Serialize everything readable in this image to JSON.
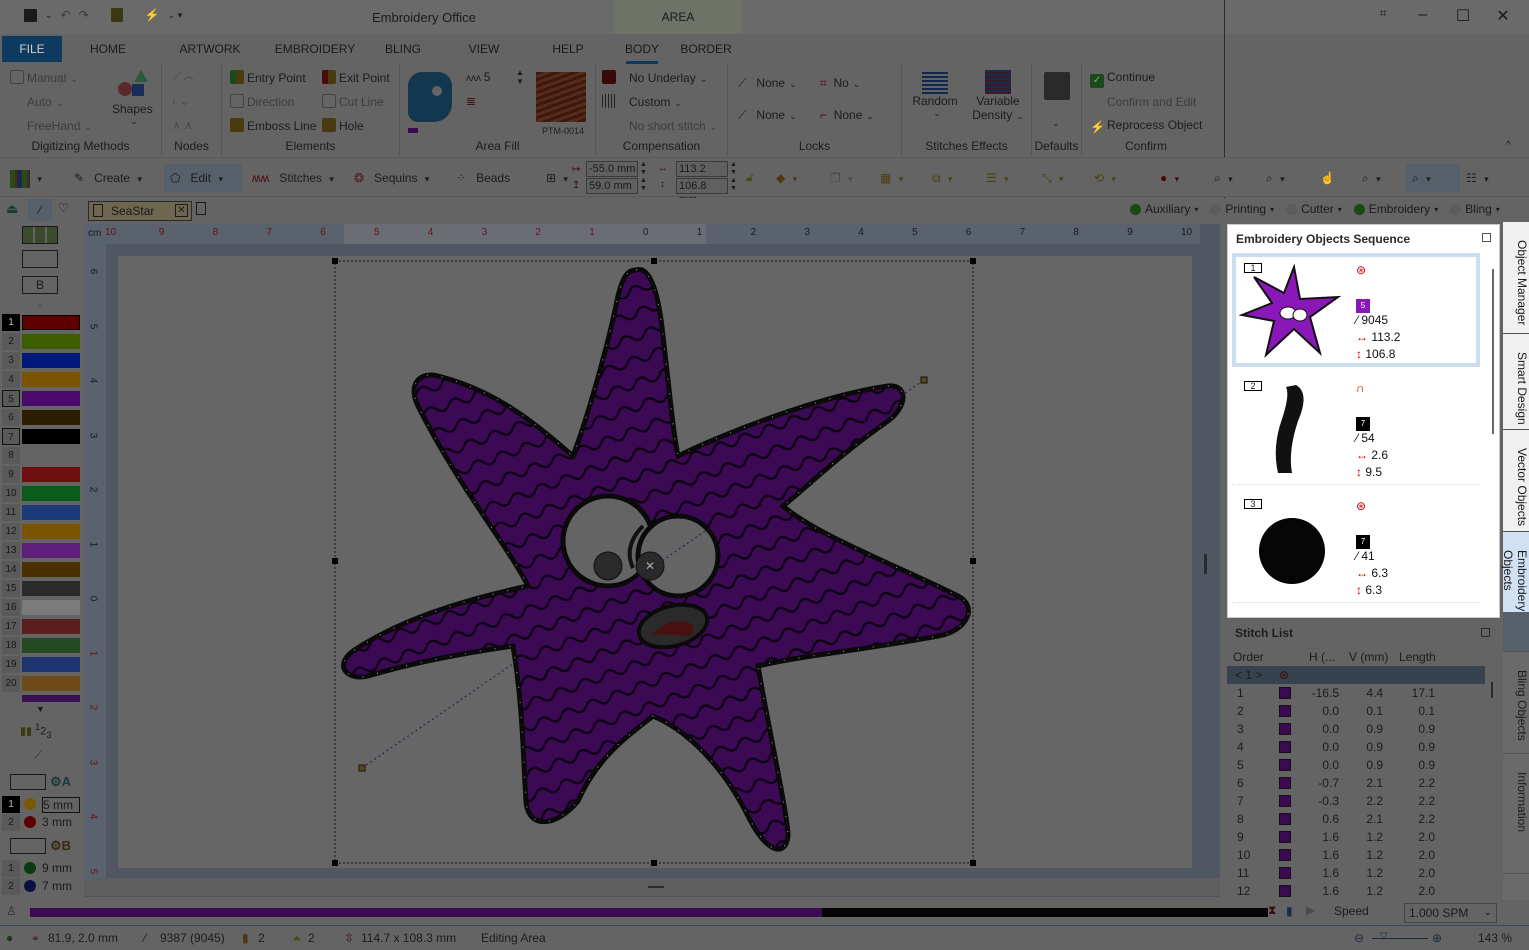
{
  "window": {
    "title": "Embroidery Office",
    "context_tab_group": "AREA",
    "controls": [
      "screenshot-icon",
      "minimize-icon",
      "maximize-icon",
      "close-icon"
    ]
  },
  "quick_access": [
    "save-icon",
    "undo-icon",
    "redo-icon",
    "paste-icon",
    "reprocess-icon"
  ],
  "tabs": [
    {
      "label": "FILE",
      "active": false
    },
    {
      "label": "HOME",
      "active": false
    },
    {
      "label": "ARTWORK",
      "active": false
    },
    {
      "label": "EMBROIDERY",
      "active": false
    },
    {
      "label": "BLING",
      "active": false
    },
    {
      "label": "VIEW",
      "active": false
    },
    {
      "label": "HELP",
      "active": false
    },
    {
      "label": "BODY",
      "active": true
    },
    {
      "label": "BORDER",
      "active": false
    }
  ],
  "ribbon": {
    "digitizing": {
      "label": "Digitizing Methods",
      "manual": "Manual",
      "auto": "Auto",
      "freehand": "FreeHand",
      "shapes": "Shapes"
    },
    "nodes": {
      "label": "Nodes"
    },
    "elements": {
      "label": "Elements",
      "entry_point": "Entry Point",
      "exit_point": "Exit Point",
      "direction": "Direction",
      "cut_line": "Cut Line",
      "emboss_line": "Emboss Line",
      "hole": "Hole"
    },
    "area_fill": {
      "label": "Area Fill",
      "density": "5",
      "pattern_name": "PTM-0014"
    },
    "compensation": {
      "label": "Compensation",
      "underlay": "No Underlay",
      "custom": "Custom",
      "short_stitch": "No short stitch"
    },
    "locks": {
      "label": "Locks",
      "start_lock": "None",
      "end_lock": "None",
      "trim_start": "No",
      "trim_end": "None"
    },
    "stitch_effects": {
      "label": "Stitches Effects",
      "random": "Random",
      "variable_density_1": "Variable",
      "variable_density_2": "Density"
    },
    "defaults": {
      "label": "Defaults"
    },
    "confirm": {
      "label": "Confirm",
      "continue": "Continue",
      "confirm_edit": "Confirm and Edit",
      "reprocess": "Reprocess Object"
    }
  },
  "toolbar": {
    "create": "Create",
    "edit": "Edit",
    "stitches": "Stitches",
    "sequins": "Sequins",
    "beads": "Beads",
    "pos_x": "-55.0 mm",
    "pos_y": "59.0 mm",
    "width": "113.2 mm",
    "height": "106.8 mm"
  },
  "document": {
    "tab_name": "SeaStar",
    "ruler_unit": "cm"
  },
  "layer_filters": [
    {
      "label": "Auxiliary",
      "on": true
    },
    {
      "label": "Printing",
      "on": false
    },
    {
      "label": "Cutter",
      "on": false
    },
    {
      "label": "Embroidery",
      "on": true
    },
    {
      "label": "Bling",
      "on": false
    }
  ],
  "palette": {
    "colors": [
      {
        "n": "1",
        "hex": "#5e0000",
        "sel": true
      },
      {
        "n": "2",
        "hex": "#3e5c00"
      },
      {
        "n": "3",
        "hex": "#001a7a"
      },
      {
        "n": "4",
        "hex": "#7a5400"
      },
      {
        "n": "5",
        "hex": "#4a0a6a",
        "box": true
      },
      {
        "n": "6",
        "hex": "#2e1e00"
      },
      {
        "n": "7",
        "hex": "#000000",
        "box": true
      },
      {
        "n": "8",
        "hex": "#646464"
      },
      {
        "n": "9",
        "hex": "#6e1010"
      },
      {
        "n": "10",
        "hex": "#0a5a1a"
      },
      {
        "n": "11",
        "hex": "#1c3a7a"
      },
      {
        "n": "12",
        "hex": "#7a5400"
      },
      {
        "n": "13",
        "hex": "#5e1e7a"
      },
      {
        "n": "14",
        "hex": "#4a3000"
      },
      {
        "n": "15",
        "hex": "#2a2a2a"
      },
      {
        "n": "16",
        "hex": "#7a7a7a"
      },
      {
        "n": "17",
        "hex": "#5a1e1e"
      },
      {
        "n": "18",
        "hex": "#244a24"
      },
      {
        "n": "19",
        "hex": "#1e3470"
      },
      {
        "n": "20",
        "hex": "#6e4a18"
      }
    ],
    "sequins_a": [
      {
        "n": "1",
        "size": "5 mm",
        "color": "#7a5a00",
        "sel": true
      },
      {
        "n": "2",
        "size": "3 mm",
        "color": "#5a0000"
      }
    ],
    "sequins_b": [
      {
        "n": "1",
        "size": "9 mm",
        "color": "#0a3a10"
      },
      {
        "n": "2",
        "size": "7 mm",
        "color": "#0a1040"
      }
    ],
    "set_a": "A",
    "set_b": "B",
    "b_button": "B"
  },
  "sequence_panel": {
    "title": "Embroidery Objects Sequence",
    "items": [
      {
        "num": "1",
        "type": "area-fill",
        "color_num": "5",
        "color": "#8a18b8",
        "stitches": "9045",
        "width": "113.2",
        "height": "106.8"
      },
      {
        "num": "2",
        "type": "satin-line",
        "color_num": "7",
        "color": "#000000",
        "stitches": "54",
        "width": "2.6",
        "height": "9.5"
      },
      {
        "num": "3",
        "type": "area-fill",
        "color_num": "7",
        "color": "#000000",
        "stitches": "41",
        "width": "6.3",
        "height": "6.3"
      }
    ]
  },
  "stitch_list": {
    "title": "Stitch List",
    "columns": [
      "Order",
      "",
      "H (...",
      "V (mm)",
      "Length"
    ],
    "group_label": "< 1 >",
    "rows": [
      {
        "order": "1",
        "h": "-16.5",
        "v": "4.4",
        "len": "17.1"
      },
      {
        "order": "2",
        "h": "0.0",
        "v": "0.1",
        "len": "0.1"
      },
      {
        "order": "3",
        "h": "0.0",
        "v": "0.9",
        "len": "0.9"
      },
      {
        "order": "4",
        "h": "0.0",
        "v": "0.9",
        "len": "0.9"
      },
      {
        "order": "5",
        "h": "0.0",
        "v": "0.9",
        "len": "0.9"
      },
      {
        "order": "6",
        "h": "-0.7",
        "v": "2.1",
        "len": "2.2"
      },
      {
        "order": "7",
        "h": "-0.3",
        "v": "2.2",
        "len": "2.2"
      },
      {
        "order": "8",
        "h": "0.6",
        "v": "2.1",
        "len": "2.2"
      },
      {
        "order": "9",
        "h": "1.6",
        "v": "1.2",
        "len": "2.0"
      },
      {
        "order": "10",
        "h": "1.6",
        "v": "1.2",
        "len": "2.0"
      },
      {
        "order": "11",
        "h": "1.6",
        "v": "1.2",
        "len": "2.0"
      },
      {
        "order": "12",
        "h": "1.6",
        "v": "1.2",
        "len": "2.0"
      }
    ]
  },
  "side_tabs": [
    "Object Manager",
    "Smart Design",
    "Vector Objects",
    "Embroidery Objects",
    "Bling Objects",
    "Information"
  ],
  "playback": {
    "progress_fraction": 0.64,
    "speed_label": "Speed",
    "speed_value": "1.000 SPM"
  },
  "status": {
    "coords": "81.9, 2.0 mm",
    "stitches": "9387 (9045)",
    "colors": "2",
    "stops": "2",
    "size": "114.7 x 108.3 mm",
    "mode": "Editing Area",
    "zoom": "143 %"
  }
}
